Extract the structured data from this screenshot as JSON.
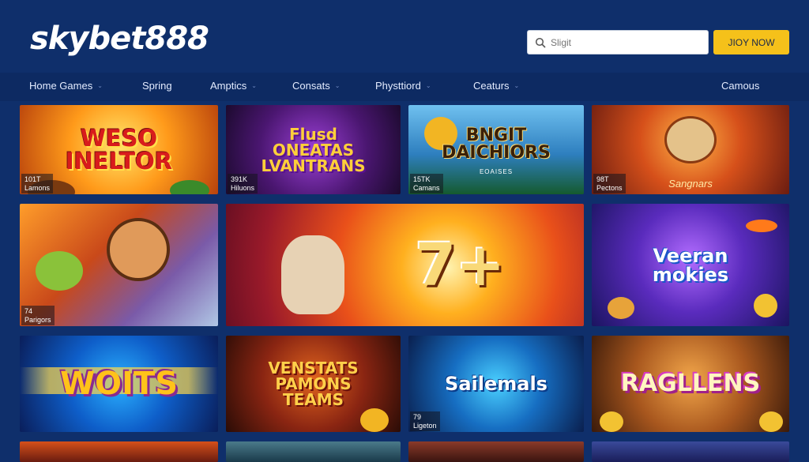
{
  "header": {
    "logo": "skybet888",
    "search_placeholder": "Sligit",
    "join_label": "JIOY NOW"
  },
  "nav": [
    {
      "label": "Home Games",
      "chevron": true
    },
    {
      "label": "Spring",
      "chevron": false
    },
    {
      "label": "Amptics",
      "chevron": true
    },
    {
      "label": "Consats",
      "chevron": true
    },
    {
      "label": "Physttiord",
      "chevron": true
    },
    {
      "label": "Ceaturs",
      "chevron": true
    },
    {
      "label": "Camous",
      "chevron": false
    }
  ],
  "tiles": [
    {
      "title": "WESO INELTOR",
      "stat_count": "101T",
      "stat_label": "Lamons"
    },
    {
      "title": "Flusd ONEATAS LVANTRANS",
      "stat_count": "391K",
      "stat_label": "Hiluons"
    },
    {
      "title": "BNGIT DAICHIORS",
      "subtitle": "EOAISES",
      "stat_count": "15TK",
      "stat_label": "Camans"
    },
    {
      "title": "Sangnars",
      "stat_count": "98T",
      "stat_label": "Pectons"
    },
    {
      "title": "",
      "stat_count": "74",
      "stat_label": "Parigors"
    },
    {
      "title": "7+"
    },
    {
      "title": "Veeran mokies"
    },
    {
      "title": "WOITS"
    },
    {
      "title": "VENSTATS PAMONS TEAMS"
    },
    {
      "title": "Sailemals",
      "stat_count": "79",
      "stat_label": "Ligeton"
    },
    {
      "title": "RAGLLENS"
    }
  ],
  "colors": {
    "background": "#0f2f6b",
    "nav_bar": "#0d2a62",
    "accent_button": "#f5c11a",
    "logo_text": "#ffffff"
  }
}
